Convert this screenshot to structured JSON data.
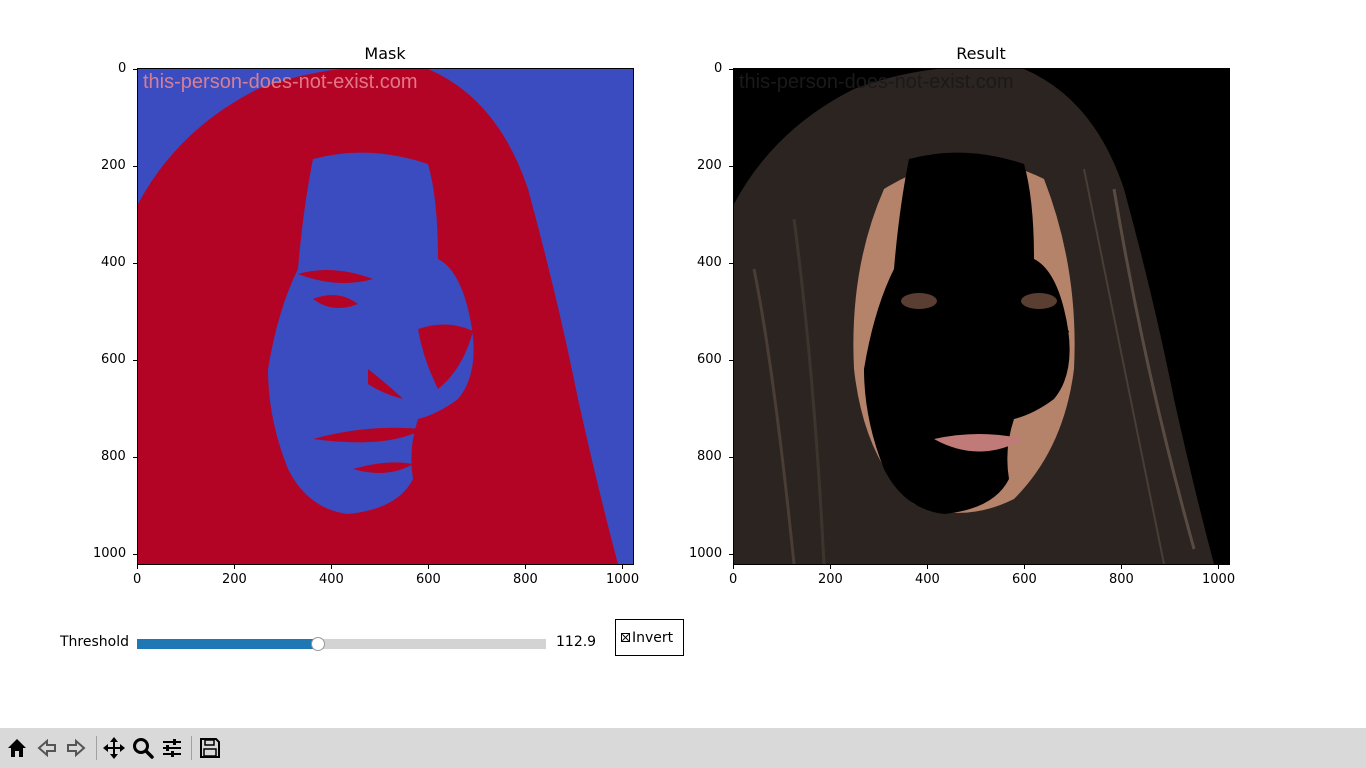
{
  "figure": {
    "mask_title": "Mask",
    "result_title": "Result",
    "mask_watermark": "this-person-does-not-exist.com",
    "result_watermark": "this-person-does-not-exist.com",
    "x_ticks": [
      "0",
      "200",
      "400",
      "600",
      "800",
      "1000"
    ],
    "y_ticks": [
      "0",
      "200",
      "400",
      "600",
      "800",
      "1000"
    ],
    "mask_colors": {
      "background": "#3b4cc0",
      "foreground": "#b40426"
    }
  },
  "controls": {
    "threshold_label": "Threshold",
    "threshold_value_text": "112.9",
    "threshold_fraction": 0.443,
    "invert_label": "Invert",
    "invert_checked": true
  },
  "toolbar": {
    "buttons": [
      "home-icon",
      "back-icon",
      "forward-icon",
      "pan-icon",
      "zoom-icon",
      "configure-subplots-icon",
      "save-icon"
    ]
  },
  "colors": {
    "slider_fill": "#1f77b4",
    "slider_track": "#d3d3d3",
    "toolbar_bg": "#d9d9d9"
  }
}
